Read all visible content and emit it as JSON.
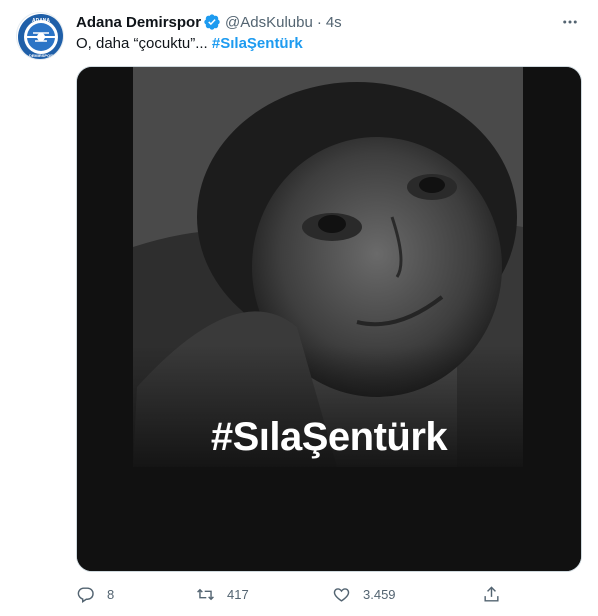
{
  "author": {
    "display_name": "Adana Demirspor",
    "handle": "@AdsKulubu",
    "separator": "·",
    "time": "4s",
    "avatar_text_top": "ADANA",
    "avatar_text_bottom": "DEMIRSPOR"
  },
  "tweet": {
    "text": "O, daha “çocuktu”... ",
    "hashtag": "#SılaŞentürk"
  },
  "media": {
    "overlay_text": "#SılaŞentürk"
  },
  "actions": {
    "replies": "8",
    "retweets": "417",
    "likes": "3.459"
  },
  "colors": {
    "accent": "#1d9bf0",
    "club_blue": "#1f5fa8",
    "text_primary": "#0f1419",
    "text_secondary": "#536471"
  },
  "icons": [
    "verified-icon",
    "more-icon",
    "reply-icon",
    "retweet-icon",
    "like-icon",
    "share-icon"
  ]
}
